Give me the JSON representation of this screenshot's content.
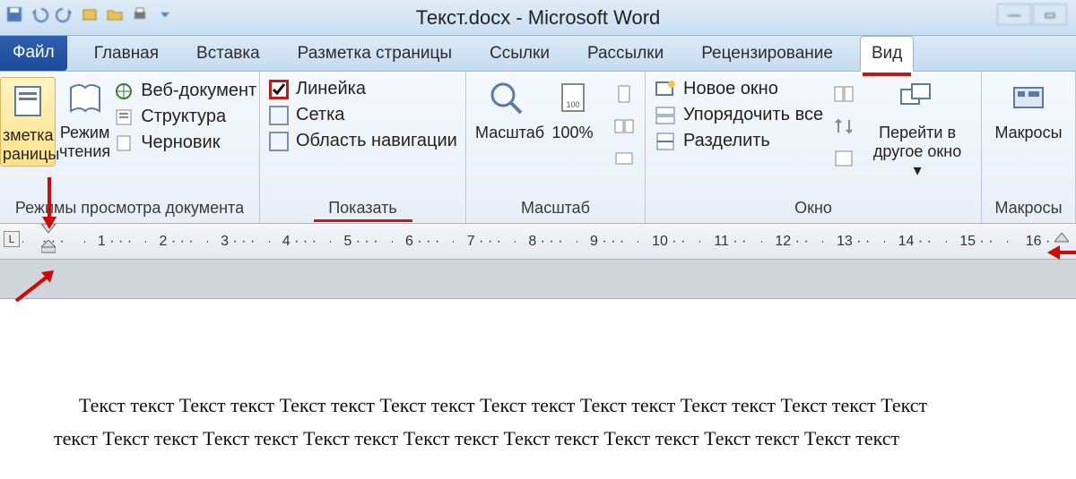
{
  "title": "Текст.docx - Microsoft Word",
  "qat_icons": [
    "save-icon",
    "undo-icon",
    "redo-icon",
    "open-icon",
    "folder-icon",
    "print-icon",
    "dropdown-icon"
  ],
  "tabs": {
    "file": "Файл",
    "items": [
      "Главная",
      "Вставка",
      "Разметка страницы",
      "Ссылки",
      "Рассылки",
      "Рецензирование",
      "Вид"
    ],
    "active_index": 6
  },
  "ribbon": {
    "views": {
      "label": "Режимы просмотра документа",
      "print_layout_top": "зметка",
      "print_layout_bot": "раницы",
      "reading_top": "Режим",
      "reading_bot": "чтения",
      "web": "Веб-документ",
      "outline": "Структура",
      "draft": "Черновик"
    },
    "show": {
      "label": "Показать",
      "ruler": "Линейка",
      "ruler_checked": true,
      "grid": "Сетка",
      "nav": "Область навигации"
    },
    "zoom": {
      "label": "Масштаб",
      "zoom": "Масштаб",
      "hundred": "100%"
    },
    "window": {
      "label": "Окно",
      "new": "Новое окно",
      "arrange": "Упорядочить все",
      "split": "Разделить",
      "switch_top": "Перейти в",
      "switch_bot": "другое окно"
    },
    "macros": {
      "label": "Макросы",
      "btn": "Макросы"
    }
  },
  "ruler_numbers": [
    "1",
    "2",
    "3",
    "4",
    "5",
    "6",
    "7",
    "8",
    "9",
    "10",
    "11",
    "12",
    "13",
    "14",
    "15",
    "16"
  ],
  "document": {
    "line1": "Текст текст Текст текст Текст текст Текст текст Текст текст Текст текст Текст текст Текст текст Текст",
    "line2": "текст Текст текст Текст текст Текст текст Текст текст Текст текст Текст текст Текст текст Текст текст"
  }
}
